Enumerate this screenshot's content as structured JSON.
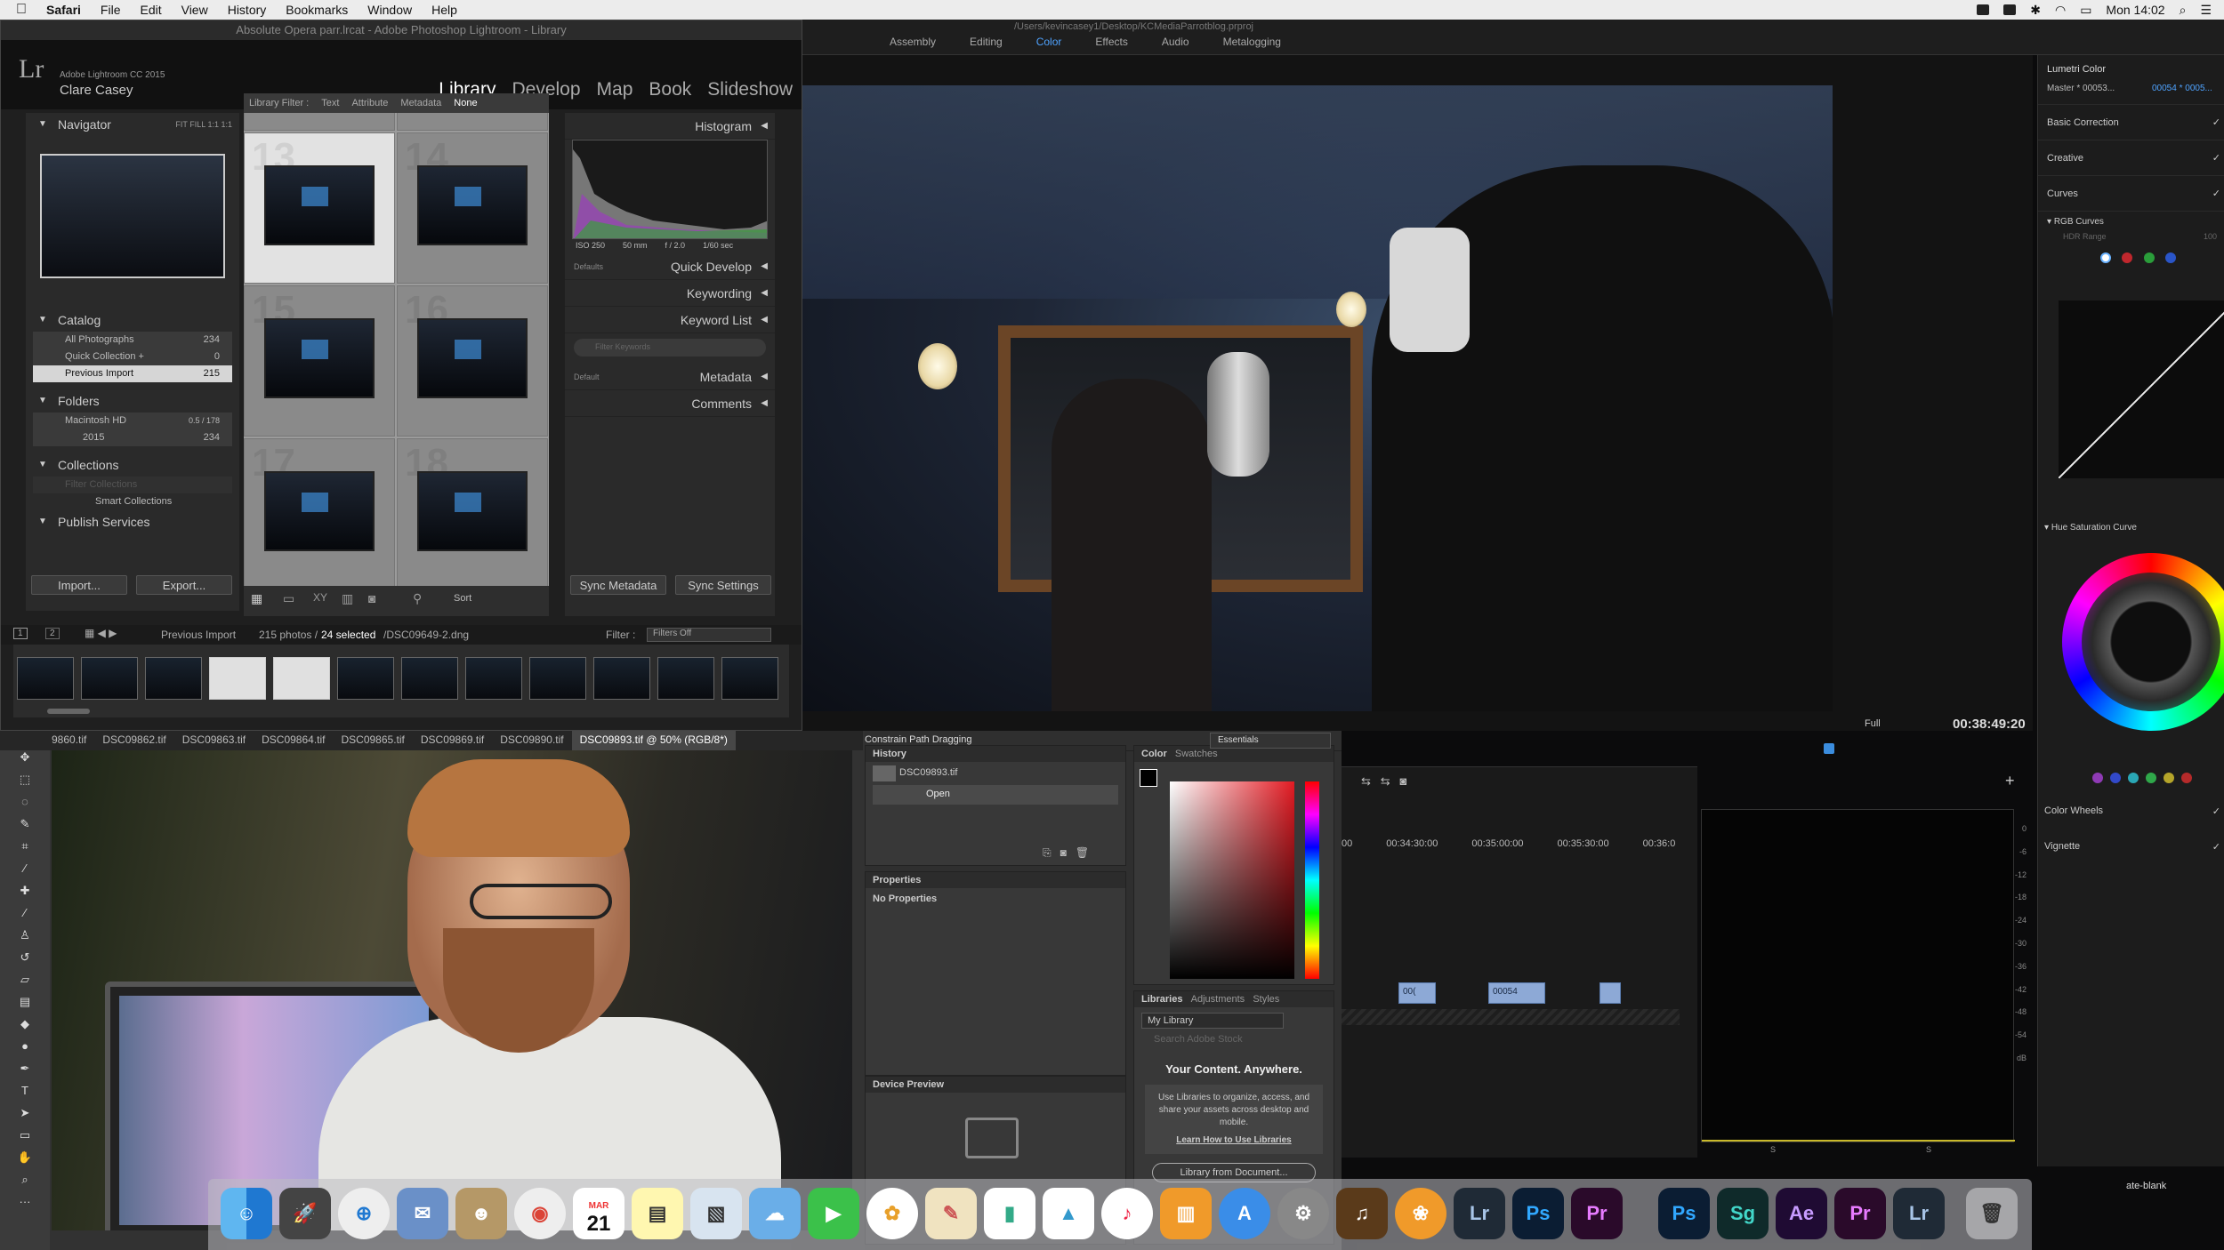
{
  "menubar": {
    "app": "Safari",
    "items": [
      "File",
      "Edit",
      "View",
      "History",
      "Bookmarks",
      "Window",
      "Help"
    ],
    "clock": "Mon 14:02"
  },
  "premiere": {
    "path": "/Users/kevincasey1/Desktop/KCMediaParrotblog.prproj",
    "workspaces": [
      "Assembly",
      "Editing",
      "Color",
      "Effects",
      "Audio",
      "Metalogging"
    ],
    "active_workspace": "Color",
    "fit": "Full",
    "timecode": "00:38:49:20",
    "ruler": [
      "00",
      "00:34:30:00",
      "00:35:00:00",
      "00:35:30:00",
      "00:36:0"
    ],
    "clips": [
      "00(",
      "00054",
      ""
    ],
    "scope_scale": [
      "0",
      "-6",
      "-12",
      "-18",
      "-24",
      "-30",
      "-36",
      "-42",
      "-48",
      "-54",
      "dB"
    ],
    "scope_footer": [
      "S",
      "S"
    ]
  },
  "lumetri": {
    "title": "Lumetri Color",
    "master": "Master * 00053...",
    "clip": "00054 * 0005...",
    "sections": [
      "Basic Correction",
      "Creative",
      "Curves"
    ],
    "rgb_curves": "RGB Curves",
    "hdr_range": "HDR Range",
    "hdr_value": "100",
    "hue_sat": "Hue Saturation Curve",
    "bottom": [
      "Color Wheels",
      "Vignette"
    ],
    "channel_colors": [
      "#ffffff",
      "#c0272d",
      "#2a9d3a",
      "#2a55c8"
    ],
    "hue_dots": [
      "#8f3ab5",
      "#3249c9",
      "#2aa7b5",
      "#2fa84a",
      "#b5a52a",
      "#b52a2a"
    ]
  },
  "lightroom": {
    "window_title": "Absolute Opera parr.lrcat - Adobe Photoshop Lightroom - Library",
    "product": "Adobe Lightroom CC 2015",
    "user": "Clare Casey",
    "modules": [
      "Library",
      "Develop",
      "Map",
      "Book",
      "Slideshow"
    ],
    "navigator": "Navigator",
    "nav_zoom": [
      "FIT",
      "FILL",
      "1:1",
      "1:1"
    ],
    "filter_label": "Library Filter :",
    "filters": [
      "Text",
      "Attribute",
      "Metadata",
      "None"
    ],
    "catalog": {
      "title": "Catalog",
      "items": [
        {
          "label": "All Photographs",
          "count": "234"
        },
        {
          "label": "Quick Collection +",
          "count": "0"
        },
        {
          "label": "Previous Import",
          "count": "215"
        }
      ]
    },
    "folders": {
      "title": "Folders",
      "disk": "Macintosh HD",
      "disk_size": "0.5 / 178",
      "sub": "2015",
      "sub_count": "234"
    },
    "collections": {
      "title": "Collections",
      "placeholder": "Filter Collections",
      "item": "Smart Collections"
    },
    "publish": "Publish Services",
    "import_label": "Import...",
    "export_label": "Export...",
    "histogram": {
      "title": "Histogram",
      "iso": "ISO 250",
      "focal": "50 mm",
      "aperture": "f / 2.0",
      "shutter": "1/60 sec"
    },
    "right_panels": [
      "Quick Develop",
      "Keywording",
      "Keyword List",
      "Metadata",
      "Comments"
    ],
    "qd_preset": "Defaults",
    "md_preset": "Default",
    "keyword_placeholder": "Filter Keywords",
    "sync_metadata": "Sync Metadata",
    "sync_settings": "Sync Settings",
    "sort_label": "Sort",
    "grid_numbers": [
      "13",
      "14",
      "15",
      "16",
      "17",
      "18"
    ],
    "filmstrip_info": {
      "source": "Previous Import",
      "count": "215 photos /",
      "selected": "24 selected",
      "file": "/DSC09649-2.dng"
    },
    "filter_right": "Filter :",
    "filters_off": "Filters Off",
    "pages": [
      "1",
      "2"
    ]
  },
  "photoshop": {
    "tabs": [
      "9860.tif",
      "DSC09862.tif",
      "DSC09863.tif",
      "DSC09864.tif",
      "DSC09865.tif",
      "DSC09869.tif",
      "DSC09890.tif",
      "DSC09893.tif @ 50% (RGB/8*)"
    ],
    "constrain": "Constrain Path Dragging",
    "workspace": "Essentials",
    "history_title": "History",
    "history_items": [
      "DSC09893.tif",
      "Open"
    ],
    "properties_title": "Properties",
    "properties_empty": "No Properties",
    "device_preview": "Device Preview",
    "color_tabs": [
      "Color",
      "Swatches"
    ],
    "libraries_tabs": [
      "Libraries",
      "Adjustments",
      "Styles"
    ],
    "library_name": "My Library",
    "stock_placeholder": "Search Adobe Stock",
    "lib_heading": "Your Content. Anywhere.",
    "lib_body": "Use Libraries to organize, access, and share your assets across desktop and mobile.",
    "lib_link": "Learn How to Use Libraries",
    "lib_button": "Library from Document..."
  },
  "dock": {
    "calendar_month": "MAR",
    "calendar_day": "21",
    "apps": [
      {
        "label": "Lr",
        "color": "#1f2a36",
        "fg": "#a8c5e8"
      },
      {
        "label": "Ps",
        "color": "#0b1d33",
        "fg": "#31a8ff"
      },
      {
        "label": "Pr",
        "color": "#2a0a2a",
        "fg": "#e77bff"
      },
      {
        "label": "Ps",
        "color": "#0b1d33",
        "fg": "#31a8ff"
      },
      {
        "label": "Sg",
        "color": "#0f2a2a",
        "fg": "#42d6c9"
      },
      {
        "label": "Ae",
        "color": "#1f0b33",
        "fg": "#c79bff"
      },
      {
        "label": "Pr",
        "color": "#2a0a2a",
        "fg": "#e77bff"
      },
      {
        "label": "Lr",
        "color": "#1f2a36",
        "fg": "#a8c5e8"
      }
    ]
  },
  "desktop_label": "ate-blank"
}
